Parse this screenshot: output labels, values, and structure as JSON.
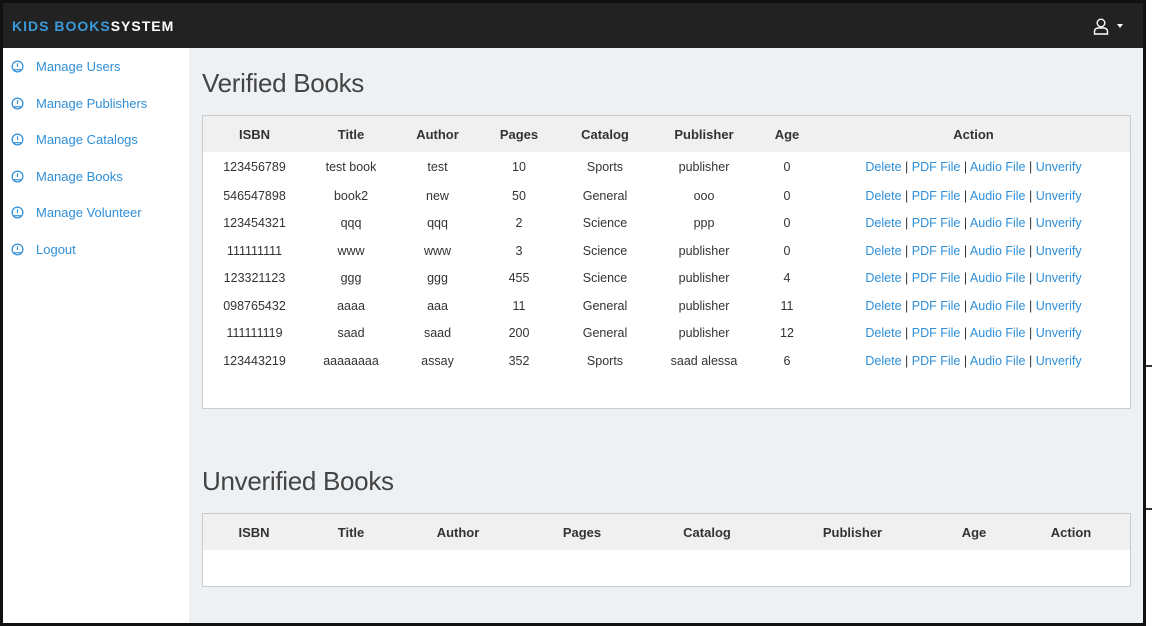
{
  "brand": {
    "part1": "KIDS BOOKS",
    "part2": "SYSTEM"
  },
  "sidebar": {
    "items": [
      {
        "label": "Manage Users"
      },
      {
        "label": "Manage Publishers"
      },
      {
        "label": "Manage Catalogs"
      },
      {
        "label": "Manage Books"
      },
      {
        "label": "Manage Volunteer"
      },
      {
        "label": "Logout"
      }
    ]
  },
  "verified": {
    "title": "Verified Books",
    "columns": [
      "ISBN",
      "Title",
      "Author",
      "Pages",
      "Catalog",
      "Publisher",
      "Age",
      "Action"
    ],
    "rows": [
      [
        "123456789",
        "test book",
        "test",
        "10",
        "Sports",
        "publisher",
        "0"
      ],
      [
        "546547898",
        "book2",
        "new",
        "50",
        "General",
        "ooo",
        "0"
      ],
      [
        "123454321",
        "qqq",
        "qqq",
        "2",
        "Science",
        "ppp",
        "0"
      ],
      [
        "111111111",
        "www",
        "www",
        "3",
        "Science",
        "publisher",
        "0"
      ],
      [
        "123321123",
        "ggg",
        "ggg",
        "455",
        "Science",
        "publisher",
        "4"
      ],
      [
        "098765432",
        "aaaa",
        "aaa",
        "11",
        "General",
        "publisher",
        "11"
      ],
      [
        "111111119",
        "saad",
        "saad",
        "200",
        "General",
        "publisher",
        "12"
      ],
      [
        "123443219",
        "aaaaaaaa",
        "assay",
        "352",
        "Sports",
        "saad alessa",
        "6"
      ]
    ],
    "actions": {
      "delete": "Delete",
      "pdf": "PDF File",
      "audio": "Audio File",
      "unverify": "Unverify",
      "separator": "|"
    }
  },
  "unverified": {
    "title": "Unverified Books",
    "columns": [
      "ISBN",
      "Title",
      "Author",
      "Pages",
      "Catalog",
      "Publisher",
      "Age",
      "Action"
    ]
  },
  "icons": {
    "user": "user-icon",
    "caret": "caret-down-icon",
    "nav": "dashboard-icon"
  },
  "colors": {
    "navbar": "#222222",
    "link": "#2f8fd8",
    "brand_accent": "#3a9ad9",
    "content_bg": "#eef1f4"
  }
}
